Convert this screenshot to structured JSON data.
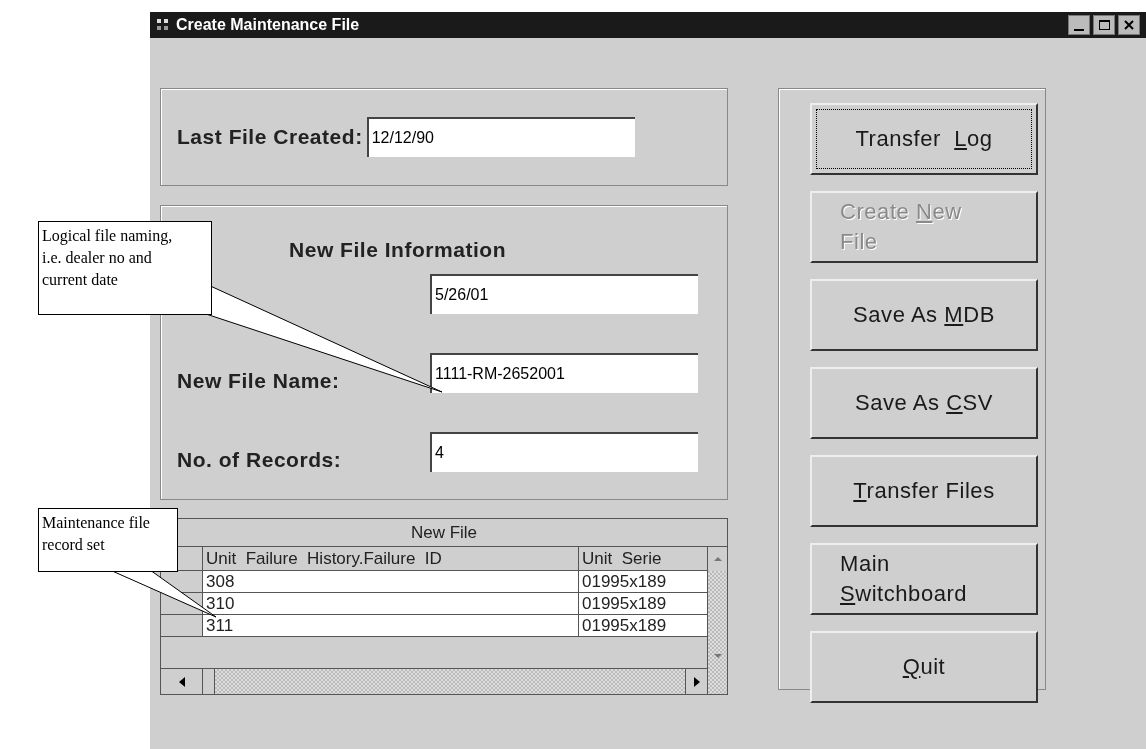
{
  "window": {
    "title": "Create Maintenance File"
  },
  "last_file": {
    "label": "Last File Created:",
    "value": "12/12/90"
  },
  "new_file_info": {
    "title": "New File Information",
    "fields": [
      {
        "value": "5/26/01"
      },
      {
        "label": "New File Name:",
        "value": "1111-RM-2652001"
      },
      {
        "label": "No. of Records:",
        "value": "4"
      }
    ]
  },
  "grid": {
    "title": "New File",
    "columns": [
      "Unit  Failure  History.Failure  ID",
      "Unit  Serie"
    ],
    "rows": [
      {
        "cells": [
          "308",
          "01995x189"
        ]
      },
      {
        "cells": [
          "310",
          "01995x189"
        ]
      },
      {
        "cells": [
          "311",
          "01995x189"
        ]
      }
    ]
  },
  "buttons": [
    {
      "disabled": false,
      "focused": true,
      "lines": [
        [
          {
            "text": "Transfer  ",
            "underline": false
          },
          {
            "text": "L",
            "underline": true
          },
          {
            "text": "og",
            "underline": false
          }
        ]
      ]
    },
    {
      "disabled": true,
      "focused": false,
      "lines": [
        [
          {
            "text": "Create ",
            "underline": false
          },
          {
            "text": "N",
            "underline": true
          },
          {
            "text": "ew",
            "underline": false
          }
        ],
        [
          {
            "text": "File",
            "underline": false
          }
        ]
      ]
    },
    {
      "disabled": false,
      "focused": false,
      "lines": [
        [
          {
            "text": "Save As ",
            "underline": false
          },
          {
            "text": "M",
            "underline": true
          },
          {
            "text": "DB",
            "underline": false
          }
        ]
      ]
    },
    {
      "disabled": false,
      "focused": false,
      "lines": [
        [
          {
            "text": "Save As ",
            "underline": false
          },
          {
            "text": "C",
            "underline": true
          },
          {
            "text": "SV",
            "underline": false
          }
        ]
      ]
    },
    {
      "disabled": false,
      "focused": false,
      "lines": [
        [
          {
            "text": "T",
            "underline": true
          },
          {
            "text": "ransfer Files",
            "underline": false
          }
        ]
      ]
    },
    {
      "disabled": false,
      "focused": false,
      "lines": [
        [
          {
            "text": "Main",
            "underline": false
          }
        ],
        [
          {
            "text": "S",
            "underline": true
          },
          {
            "text": "witchboard",
            "underline": false
          }
        ]
      ]
    },
    {
      "disabled": false,
      "focused": false,
      "lines": [
        [
          {
            "text": "Q",
            "underline": true
          },
          {
            "text": "uit",
            "underline": false
          }
        ]
      ]
    }
  ],
  "callouts": [
    {
      "text": "Logical file naming, i.e. dealer no and current date"
    },
    {
      "text": "Maintenance file record set"
    }
  ]
}
